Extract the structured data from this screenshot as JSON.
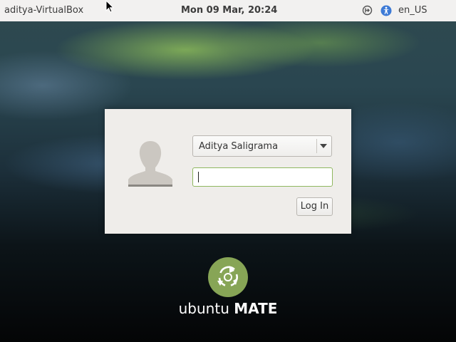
{
  "top_panel": {
    "hostname": "aditya-VirtualBox",
    "clock": "Mon 09 Mar, 20:24",
    "language": "en_US",
    "icons": [
      "session-icon",
      "accessibility-icon"
    ]
  },
  "login": {
    "avatar_icon": "user-silhouette-icon",
    "selected_user": "Aditya Saligrama",
    "password_value": "",
    "login_label": "Log In"
  },
  "branding": {
    "logo_icon": "ubuntu-mate-logo-icon",
    "text_light": "ubuntu",
    "text_bold": "MATE"
  },
  "colors": {
    "panel_bg": "#f2f1f0",
    "dialog_bg": "#efedea",
    "accent_green": "#87a556",
    "input_focus_border": "#8fb75f"
  }
}
